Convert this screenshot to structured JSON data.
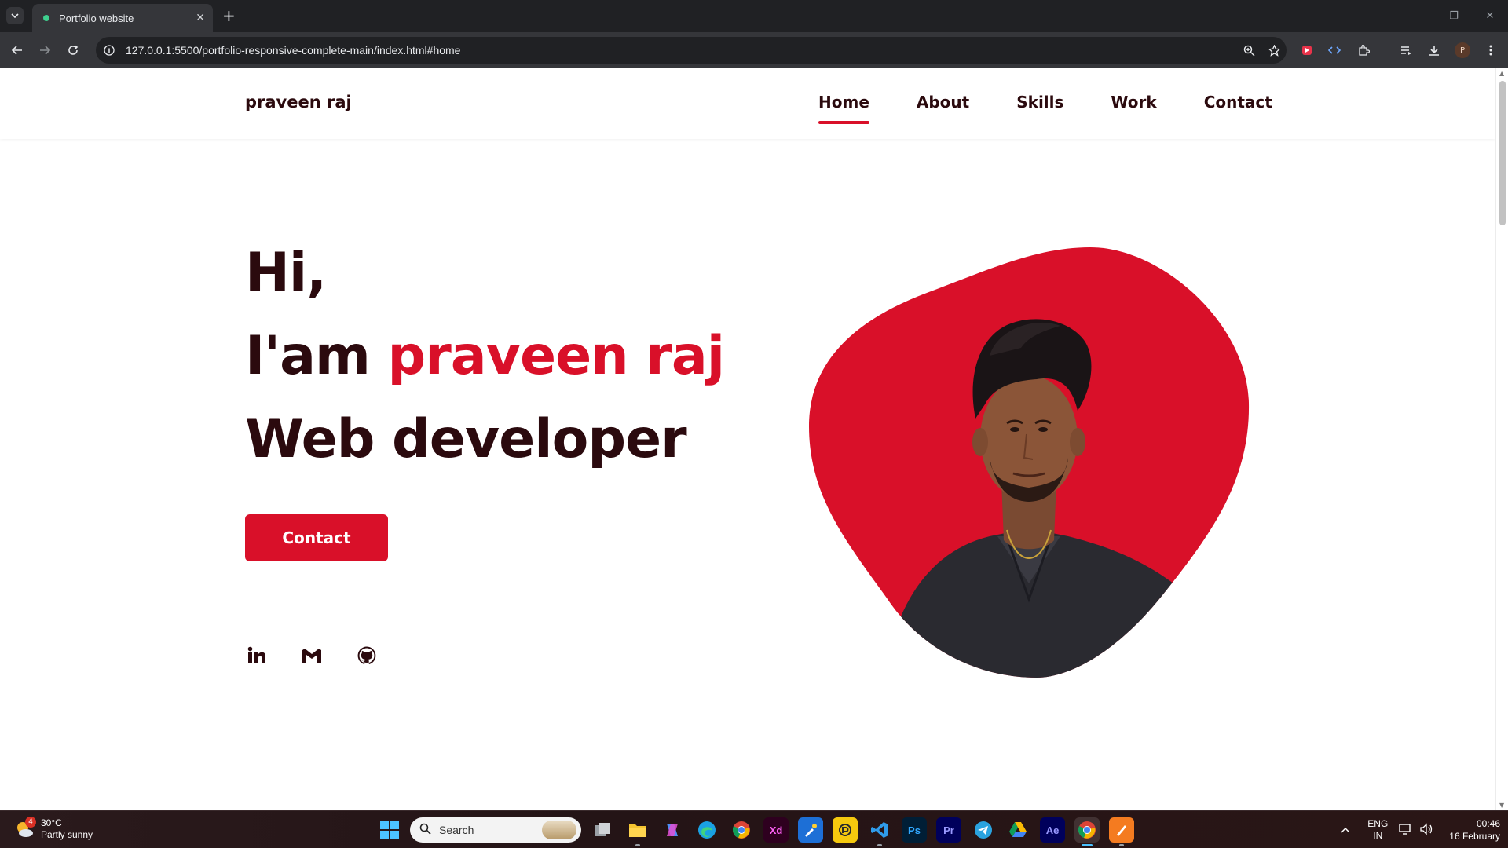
{
  "browser": {
    "tab_title": "Portfolio website",
    "url": "127.0.0.1:5500/portfolio-responsive-complete-main/index.html#home",
    "profile_initial": "P"
  },
  "site": {
    "logo": "praveen raj",
    "nav": [
      {
        "label": "Home",
        "active": true
      },
      {
        "label": "About",
        "active": false
      },
      {
        "label": "Skills",
        "active": false
      },
      {
        "label": "Work",
        "active": false
      },
      {
        "label": "Contact",
        "active": false
      }
    ],
    "hero": {
      "line1": "Hi,",
      "line2_prefix": "I'am ",
      "line2_name": "praveen raj",
      "line3": "Web developer"
    },
    "contact_button": "Contact",
    "socials": [
      "linkedin-icon",
      "gmail-icon",
      "github-icon"
    ],
    "colors": {
      "accent": "#d91029",
      "text": "#2b0a0e"
    }
  },
  "taskbar": {
    "weather_temp": "30°C",
    "weather_desc": "Partly sunny",
    "weather_badge": "4",
    "search_placeholder": "Search",
    "apps": [
      {
        "name": "task-view",
        "label": ""
      },
      {
        "name": "file-explorer",
        "label": ""
      },
      {
        "name": "copilot",
        "label": ""
      },
      {
        "name": "edge",
        "label": ""
      },
      {
        "name": "chrome",
        "label": ""
      },
      {
        "name": "adobe-xd",
        "label": "Xd"
      },
      {
        "name": "paint",
        "label": ""
      },
      {
        "name": "app-yellow",
        "label": ""
      },
      {
        "name": "vscode",
        "label": ""
      },
      {
        "name": "photoshop",
        "label": "Ps"
      },
      {
        "name": "premiere",
        "label": "Pr"
      },
      {
        "name": "telegram",
        "label": ""
      },
      {
        "name": "google-drive",
        "label": ""
      },
      {
        "name": "after-effects",
        "label": "Ae"
      },
      {
        "name": "chrome-active",
        "label": ""
      },
      {
        "name": "app-orange",
        "label": ""
      }
    ],
    "lang_top": "ENG",
    "lang_bottom": "IN",
    "time": "00:46",
    "date": "16 February"
  }
}
